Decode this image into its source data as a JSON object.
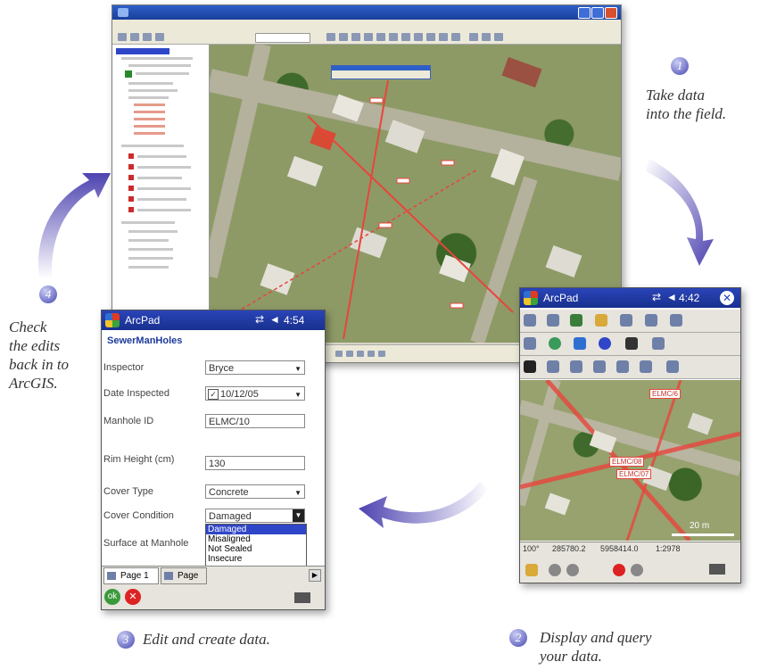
{
  "steps": [
    {
      "number": "1",
      "caption_lines": [
        "Take data",
        "into the field."
      ]
    },
    {
      "number": "2",
      "caption_lines": [
        "Display and query",
        "your data."
      ]
    },
    {
      "number": "3",
      "caption_lines": [
        "Edit and create data."
      ]
    },
    {
      "number": "4",
      "caption_lines": [
        "Check",
        "the edits",
        "back in to",
        "ArcGIS."
      ]
    }
  ],
  "colors": {
    "arrow": "#5a4fb8",
    "pda_title": "#2a44b8",
    "feature_red": "#e8453c",
    "selection": "#2f46c8"
  },
  "pda_form": {
    "app": "ArcPad",
    "time": "4:54",
    "layer": "SewerManHoles",
    "fields": [
      {
        "label": "Inspector",
        "value": "Bryce",
        "type": "dropdown"
      },
      {
        "label": "Date Inspected",
        "value": "10/12/05",
        "type": "date"
      },
      {
        "label": "Manhole ID",
        "value": "ELMC/10",
        "type": "text"
      },
      {
        "label": "Rim Height (cm)",
        "value": "130",
        "type": "text"
      },
      {
        "label": "Cover Type",
        "value": "Concrete",
        "type": "dropdown"
      },
      {
        "label": "Cover Condition",
        "value": "Damaged",
        "type": "dropdown-open"
      },
      {
        "label": "Surface at Manhole",
        "value": "",
        "type": "text"
      }
    ],
    "dropdown_options": [
      "Damaged",
      "Misaligned",
      "Not Sealed",
      "Insecure"
    ],
    "tabs": [
      "Page 1",
      "Page"
    ]
  },
  "pda_map": {
    "app": "ArcPad",
    "time": "4:42",
    "labels": [
      "ELMC/6",
      "ELMC/08",
      "ELMC/07"
    ],
    "scale_bar": "20 m",
    "status": [
      "100°",
      "285780.2",
      "5958414.0",
      "1:2978"
    ]
  }
}
